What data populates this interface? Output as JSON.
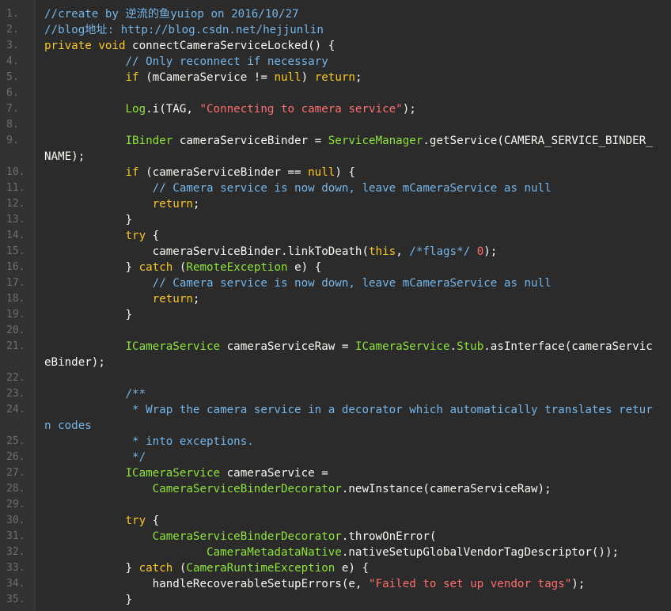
{
  "colors": {
    "background": "#2b2b2b",
    "gutter": "#323232",
    "line_number": "#6e6e6e",
    "plain": "#f8f8f2",
    "comment": "#75b5e8",
    "keyword": "#fac81e",
    "string": "#ff6e6e",
    "type": "#8fe338",
    "number": "#ff6e6e"
  },
  "lines": [
    {
      "n": "1.",
      "tokens": [
        [
          "comment",
          "//create by 逆流的鱼yuiop on 2016/10/27"
        ]
      ]
    },
    {
      "n": "2.",
      "tokens": [
        [
          "comment",
          "//blog地址: http://blog.csdn.net/hejjunlin"
        ]
      ]
    },
    {
      "n": "3.",
      "tokens": [
        [
          "kw",
          "private"
        ],
        [
          "plain",
          " "
        ],
        [
          "kw",
          "void"
        ],
        [
          "plain",
          " connectCameraServiceLocked() {"
        ]
      ]
    },
    {
      "n": "4.",
      "tokens": [
        [
          "plain",
          "            "
        ],
        [
          "comment",
          "// Only reconnect if necessary"
        ]
      ]
    },
    {
      "n": "5.",
      "tokens": [
        [
          "plain",
          "            "
        ],
        [
          "kw",
          "if"
        ],
        [
          "plain",
          " (mCameraService != "
        ],
        [
          "kw",
          "null"
        ],
        [
          "plain",
          ") "
        ],
        [
          "kw",
          "return"
        ],
        [
          "plain",
          ";"
        ]
      ]
    },
    {
      "n": "6.",
      "tokens": []
    },
    {
      "n": "7.",
      "tokens": [
        [
          "plain",
          "            "
        ],
        [
          "type",
          "Log"
        ],
        [
          "plain",
          ".i(TAG, "
        ],
        [
          "str",
          "\"Connecting to camera service\""
        ],
        [
          "plain",
          ");"
        ]
      ]
    },
    {
      "n": "8.",
      "tokens": []
    },
    {
      "n": "9.",
      "wrap": true,
      "tokens": [
        [
          "plain",
          "            "
        ],
        [
          "type",
          "IBinder"
        ],
        [
          "plain",
          " cameraServiceBinder = "
        ],
        [
          "type",
          "ServiceManager"
        ],
        [
          "plain",
          ".getService(CAMERA_SERVICE_BINDER_NAME);"
        ]
      ]
    },
    {
      "n": "10.",
      "tokens": [
        [
          "plain",
          "            "
        ],
        [
          "kw",
          "if"
        ],
        [
          "plain",
          " (cameraServiceBinder == "
        ],
        [
          "kw",
          "null"
        ],
        [
          "plain",
          ") {"
        ]
      ]
    },
    {
      "n": "11.",
      "tokens": [
        [
          "plain",
          "                "
        ],
        [
          "comment",
          "// Camera service is now down, leave mCameraService as null"
        ]
      ]
    },
    {
      "n": "12.",
      "tokens": [
        [
          "plain",
          "                "
        ],
        [
          "kw",
          "return"
        ],
        [
          "plain",
          ";"
        ]
      ]
    },
    {
      "n": "13.",
      "tokens": [
        [
          "plain",
          "            }"
        ]
      ]
    },
    {
      "n": "14.",
      "tokens": [
        [
          "plain",
          "            "
        ],
        [
          "kw",
          "try"
        ],
        [
          "plain",
          " {"
        ]
      ]
    },
    {
      "n": "15.",
      "tokens": [
        [
          "plain",
          "                cameraServiceBinder.linkToDeath("
        ],
        [
          "kw",
          "this"
        ],
        [
          "plain",
          ", "
        ],
        [
          "comment",
          "/*flags*/"
        ],
        [
          "plain",
          " "
        ],
        [
          "num",
          "0"
        ],
        [
          "plain",
          ");"
        ]
      ]
    },
    {
      "n": "16.",
      "tokens": [
        [
          "plain",
          "            } "
        ],
        [
          "kw",
          "catch"
        ],
        [
          "plain",
          " ("
        ],
        [
          "type",
          "RemoteException"
        ],
        [
          "plain",
          " e) {"
        ]
      ]
    },
    {
      "n": "17.",
      "tokens": [
        [
          "plain",
          "                "
        ],
        [
          "comment",
          "// Camera service is now down, leave mCameraService as null"
        ]
      ]
    },
    {
      "n": "18.",
      "tokens": [
        [
          "plain",
          "                "
        ],
        [
          "kw",
          "return"
        ],
        [
          "plain",
          ";"
        ]
      ]
    },
    {
      "n": "19.",
      "tokens": [
        [
          "plain",
          "            }"
        ]
      ]
    },
    {
      "n": "20.",
      "tokens": []
    },
    {
      "n": "21.",
      "wrap": true,
      "tokens": [
        [
          "plain",
          "            "
        ],
        [
          "type",
          "ICameraService"
        ],
        [
          "plain",
          " cameraServiceRaw = "
        ],
        [
          "type",
          "ICameraService"
        ],
        [
          "plain",
          "."
        ],
        [
          "type",
          "Stub"
        ],
        [
          "plain",
          ".asInterface(cameraServiceBinder);"
        ]
      ]
    },
    {
      "n": "22.",
      "tokens": []
    },
    {
      "n": "23.",
      "tokens": [
        [
          "plain",
          "            "
        ],
        [
          "comment",
          "/**"
        ]
      ]
    },
    {
      "n": "24.",
      "wrap": true,
      "tokens": [
        [
          "plain",
          "             "
        ],
        [
          "comment",
          "* Wrap the camera service in a decorator which automatically translates return codes"
        ]
      ]
    },
    {
      "n": "25.",
      "tokens": [
        [
          "plain",
          "             "
        ],
        [
          "comment",
          "* into exceptions."
        ]
      ]
    },
    {
      "n": "26.",
      "tokens": [
        [
          "plain",
          "             "
        ],
        [
          "comment",
          "*/"
        ]
      ]
    },
    {
      "n": "27.",
      "tokens": [
        [
          "plain",
          "            "
        ],
        [
          "type",
          "ICameraService"
        ],
        [
          "plain",
          " cameraService ="
        ]
      ]
    },
    {
      "n": "28.",
      "tokens": [
        [
          "plain",
          "                "
        ],
        [
          "type",
          "CameraServiceBinderDecorator"
        ],
        [
          "plain",
          ".newInstance(cameraServiceRaw);"
        ]
      ]
    },
    {
      "n": "29.",
      "tokens": []
    },
    {
      "n": "30.",
      "tokens": [
        [
          "plain",
          "            "
        ],
        [
          "kw",
          "try"
        ],
        [
          "plain",
          " {"
        ]
      ]
    },
    {
      "n": "31.",
      "tokens": [
        [
          "plain",
          "                "
        ],
        [
          "type",
          "CameraServiceBinderDecorator"
        ],
        [
          "plain",
          ".throwOnError("
        ]
      ]
    },
    {
      "n": "32.",
      "tokens": [
        [
          "plain",
          "                        "
        ],
        [
          "type",
          "CameraMetadataNative"
        ],
        [
          "plain",
          ".nativeSetupGlobalVendorTagDescriptor());"
        ]
      ]
    },
    {
      "n": "33.",
      "tokens": [
        [
          "plain",
          "            } "
        ],
        [
          "kw",
          "catch"
        ],
        [
          "plain",
          " ("
        ],
        [
          "type",
          "CameraRuntimeException"
        ],
        [
          "plain",
          " e) {"
        ]
      ]
    },
    {
      "n": "34.",
      "tokens": [
        [
          "plain",
          "                handleRecoverableSetupErrors(e, "
        ],
        [
          "str",
          "\"Failed to set up vendor tags\""
        ],
        [
          "plain",
          ");"
        ]
      ]
    },
    {
      "n": "35.",
      "tokens": [
        [
          "plain",
          "            }"
        ]
      ]
    }
  ]
}
